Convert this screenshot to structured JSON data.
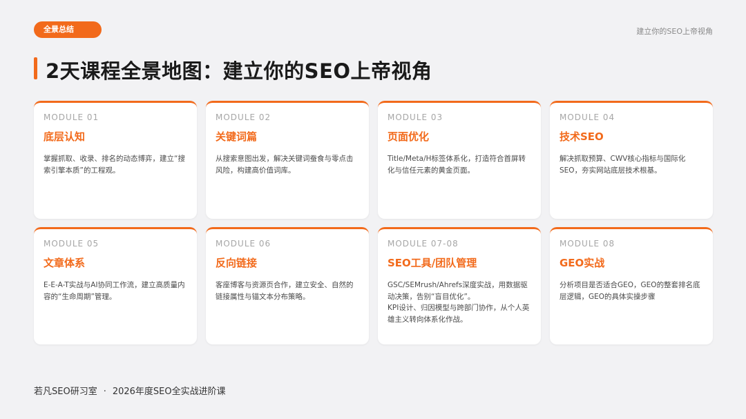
{
  "header": {
    "badge": "全景总结",
    "top_right": "建立你的SEO上帝视角",
    "title": "2天课程全景地图：建立你的SEO上帝视角"
  },
  "modules": [
    {
      "code": "MODULE 01",
      "title": "底层认知",
      "desc": "掌握抓取、收录、排名的动态博弈，建立“搜索引擎本质”的工程观。"
    },
    {
      "code": "MODULE 02",
      "title": "关键词篇",
      "desc": "从搜索意图出发，解决关键词蚕食与零点击风险，构建高价值词库。"
    },
    {
      "code": "MODULE 03",
      "title": "页面优化",
      "desc": "Title/Meta/H标签体系化，打造符合首屏转化与信任元素的黄金页面。"
    },
    {
      "code": "MODULE 04",
      "title": "技术SEO",
      "desc": "解决抓取预算、CWV核心指标与国际化SEO，夯实网站底层技术根基。"
    },
    {
      "code": "MODULE 05",
      "title": "文章体系",
      "desc": "E-E-A-T实战与AI协同工作流，建立高质量内容的“生命周期”管理。"
    },
    {
      "code": "MODULE 06",
      "title": "反向链接",
      "desc": "客座博客与资源页合作，建立安全、自然的链接属性与锚文本分布策略。"
    },
    {
      "code": "MODULE 07-08",
      "title": "SEO工具/团队管理",
      "desc": "GSC/SEMrush/Ahrefs深度实战，用数据驱动决策，告别“盲目优化”。",
      "desc2": "KPI设计、归因模型与跨部门协作，从个人英雄主义转向体系化作战。"
    },
    {
      "code": "MODULE 08",
      "title": "GEO实战",
      "desc": "分析项目是否适合GEO，GEO的整套排名底层逻辑，GEO的具体实操步骤"
    }
  ],
  "footer": {
    "studio": "若凡SEO研习室",
    "separator": "·",
    "course": "2026年度SEO全实战进阶课"
  },
  "colors": {
    "accent": "#f26a1b",
    "background": "#f2f2f4"
  }
}
